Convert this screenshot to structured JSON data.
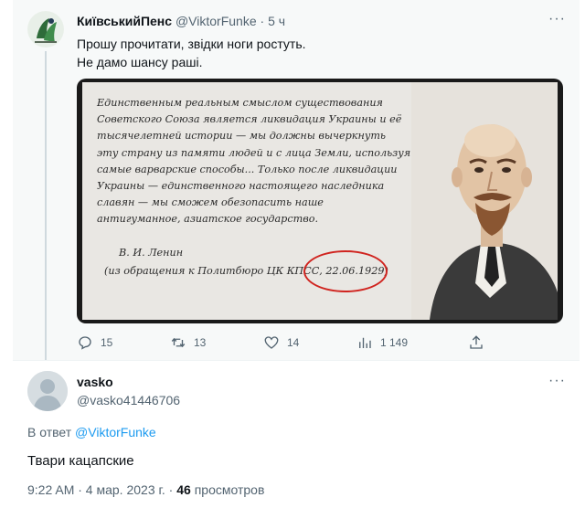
{
  "original_tweet": {
    "display_name": "КиївськийПенс",
    "handle": "@ViktorFunke",
    "separator": "·",
    "time_ago": "5 ч",
    "more_label": "···",
    "text_line1": "Прошу прочитати, звідки ноги ростуть.",
    "text_line2": "Не дамо шансу раші.",
    "image": {
      "quote_line1": "Единственным реальным смыслом существования",
      "quote_line2": "Советского Союза является ликвидация Украины и её",
      "quote_line3": "тысячелетней истории — мы должны вычеркнуть",
      "quote_line4": "эту страну из памяти людей и с лица Земли, используя",
      "quote_line5": "самые варварские способы... Только после ликвидации",
      "quote_line6": "Украины — единственного настоящего наследника",
      "quote_line7": "славян — мы сможем обезопасить наше",
      "quote_line8": "антигуманное, азиатское государство.",
      "signature": "В. И. Ленин",
      "source": "(из обращения к Политбюро ЦК КПСС, 22.06.1929)"
    },
    "actions": {
      "replies": "15",
      "retweets": "13",
      "likes": "14",
      "views": "1 149"
    }
  },
  "reply": {
    "display_name": "vasko",
    "handle": "@vasko41446706",
    "more_label": "···",
    "reply_prefix": "В ответ",
    "reply_to": "@ViktorFunke",
    "text": "Твари кацапские",
    "timestamp": "9:22 AM · 4 мар. 2023 г. · ",
    "views_count": "46",
    "views_label": "просмотров"
  },
  "colors": {
    "accent": "#1d9bf0",
    "muted": "#536471",
    "circle": "#d0241f"
  }
}
